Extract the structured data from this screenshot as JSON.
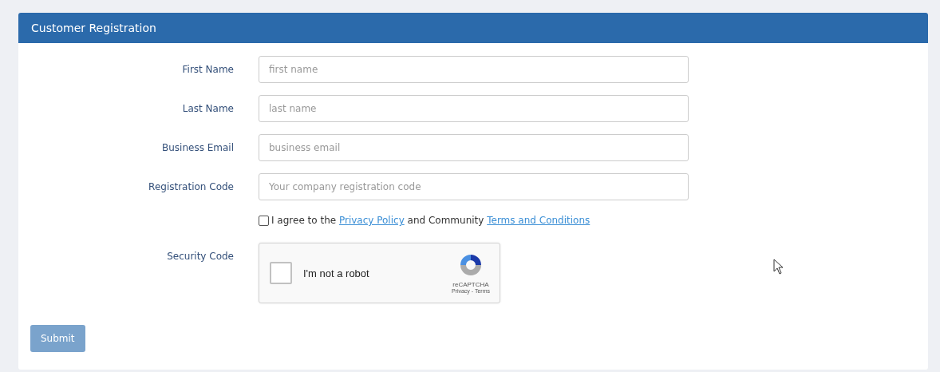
{
  "panel": {
    "title": "Customer Registration"
  },
  "fields": [
    {
      "label": "First Name",
      "placeholder": "first name"
    },
    {
      "label": "Last Name",
      "placeholder": "last name"
    },
    {
      "label": "Business Email",
      "placeholder": "business email"
    },
    {
      "label": "Registration Code",
      "placeholder": "Your company registration code"
    }
  ],
  "agreement": {
    "checked": false,
    "text_1": "I agree to the",
    "link_1": "Privacy Policy",
    "text_2": "and Community",
    "link_2": "Terms and Conditions"
  },
  "security": {
    "label": "Security Code",
    "captcha": {
      "checked": false,
      "label": "I'm not a robot",
      "brand": "reCAPTCHA",
      "links": "Privacy - Terms"
    }
  },
  "submit": {
    "label": "Submit",
    "disabled": true
  }
}
